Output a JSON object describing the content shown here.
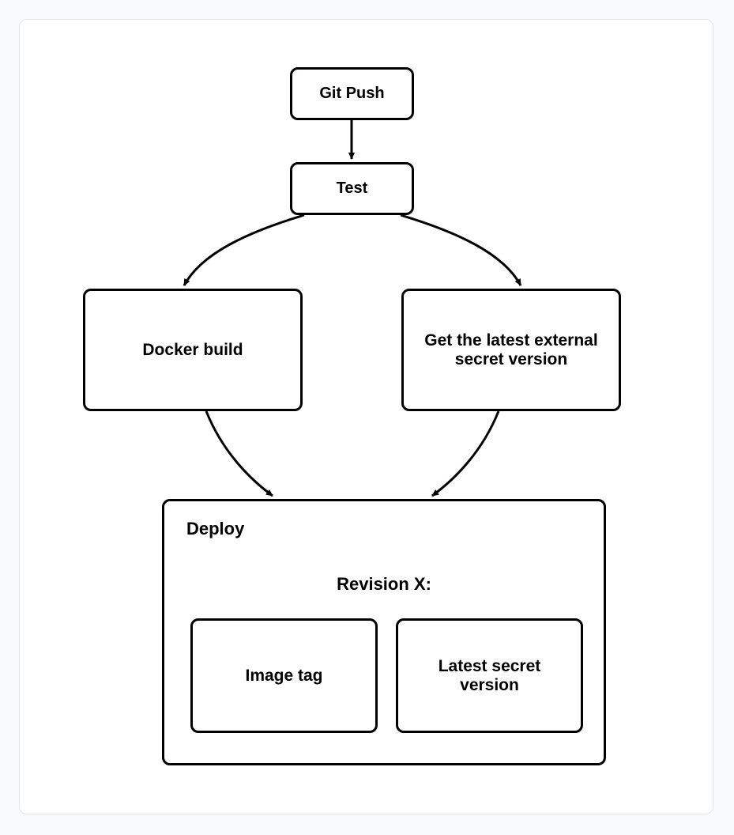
{
  "nodes": {
    "git_push": "Git Push",
    "test": "Test",
    "docker_build": "Docker build",
    "get_secret": "Get the latest external secret version",
    "deploy": "Deploy",
    "revision": "Revision X:",
    "image_tag": "Image tag",
    "latest_secret": "Latest secret version"
  },
  "diagram": {
    "type": "flowchart",
    "description": "CI/CD pipeline flow from Git Push through Test, branching to Docker build and secret retrieval, converging into Deploy which contains a revision with image tag and latest secret version.",
    "edges": [
      {
        "from": "git_push",
        "to": "test"
      },
      {
        "from": "test",
        "to": "docker_build"
      },
      {
        "from": "test",
        "to": "get_secret"
      },
      {
        "from": "docker_build",
        "to": "deploy"
      },
      {
        "from": "get_secret",
        "to": "deploy"
      }
    ],
    "containers": [
      {
        "id": "deploy",
        "children": [
          "image_tag",
          "latest_secret"
        ],
        "label_inside": "revision"
      }
    ]
  }
}
